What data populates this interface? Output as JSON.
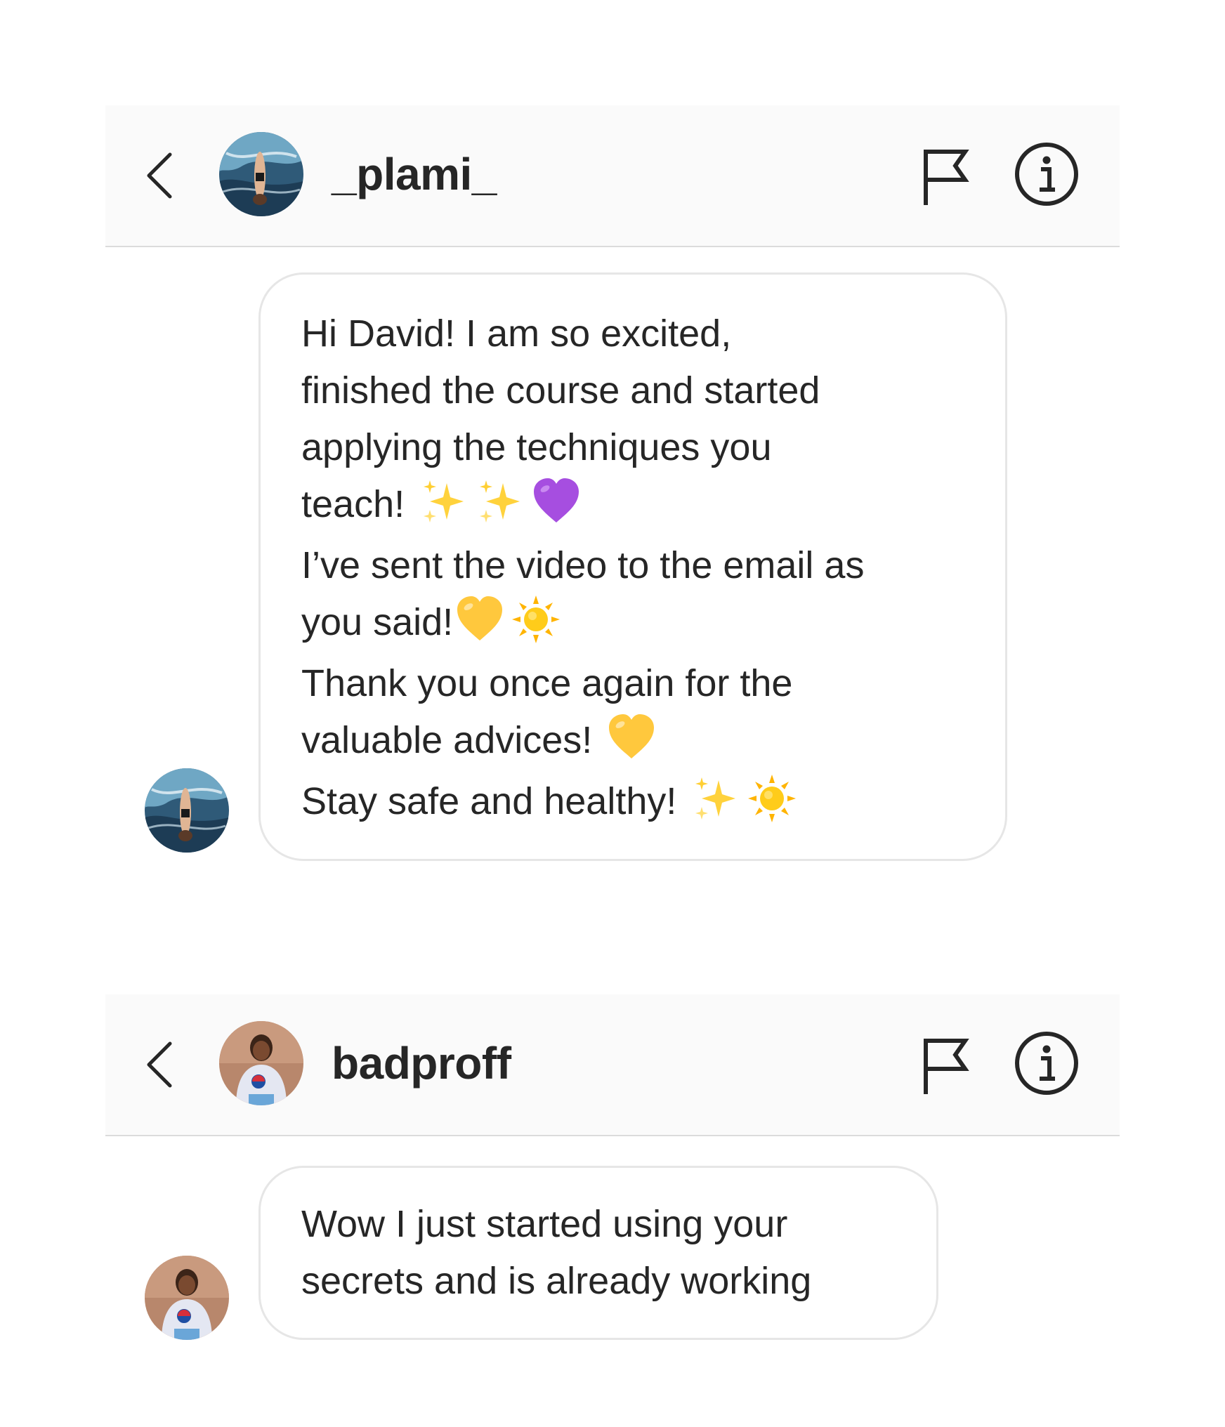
{
  "threads": [
    {
      "username": "_plami_",
      "message_lines": [
        "Hi David! I am so excited,",
        "finished the course and started",
        "applying the techniques you",
        "teach!",
        "I’ve sent the video to the email as",
        "you said!",
        "Thank you once again for the",
        "valuable advices!",
        "Stay safe and healthy!"
      ]
    },
    {
      "username": "badproff",
      "message_lines": [
        "Wow I just started using your",
        "secrets and is already working"
      ]
    }
  ],
  "icons": {
    "back": "chevron-left-icon",
    "report": "flag-icon",
    "info": "info-icon",
    "emojis": [
      "sparkles",
      "purple-heart",
      "yellow-heart",
      "sun"
    ]
  },
  "colors": {
    "header_bg": "#fafafa",
    "divider": "#dbdbdb",
    "bubble_border": "#e6e6e6",
    "text": "#262626",
    "purple_heart": "#a64ee0",
    "yellow_heart": "#ffc83d",
    "sun": "#ffb400",
    "sparkles": "#ffd23c"
  }
}
